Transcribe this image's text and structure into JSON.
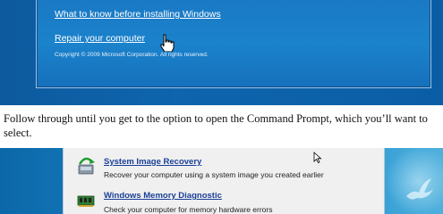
{
  "setup_screen": {
    "link_what_to_know": "What to know before installing Windows",
    "link_repair": "Repair your computer",
    "copyright": "Copyright © 2009 Microsoft Corporation. All rights reserved."
  },
  "instruction_text": "Follow through until you get to the option to open the Command Prompt, which you’ll want to select.",
  "recovery_options": {
    "items": [
      {
        "title": "System Image Recovery",
        "description": "Recover your computer using a system image you created earlier",
        "icon": "system-image-icon"
      },
      {
        "title": "Windows Memory Diagnostic",
        "description": "Check your computer for memory hardware errors",
        "icon": "memory-chip-icon"
      }
    ]
  },
  "colors": {
    "setup_blue": "#1b82cc",
    "link_blue": "#1a3f97",
    "panel_bg": "#f0f0f0"
  }
}
